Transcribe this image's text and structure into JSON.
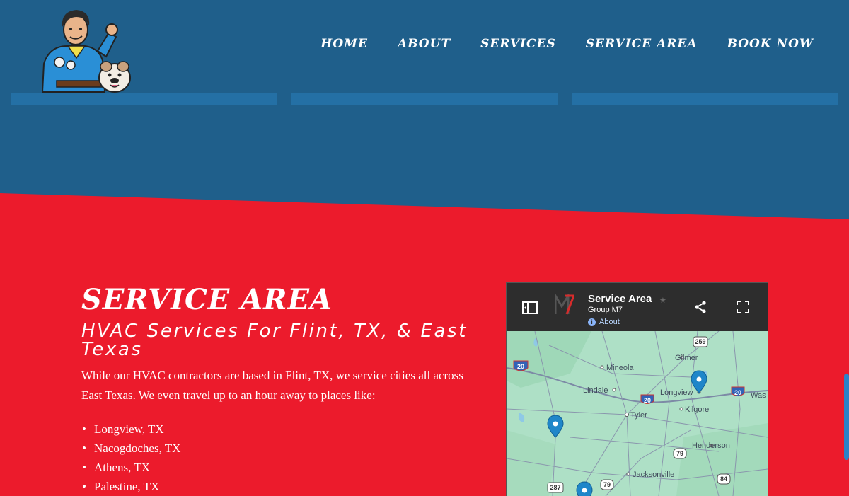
{
  "nav": {
    "items": [
      "HOME",
      "ABOUT",
      "SERVICES",
      "SERVICE AREA",
      "BOOK NOW"
    ]
  },
  "service_area": {
    "title": "SERVICE AREA",
    "subtitle": "HVAC Services For Flint, TX, & East Texas",
    "intro": "While our HVAC contractors are based in Flint, TX, we service cities all across East Texas. We even travel up to an hour away to places like:",
    "places": [
      "Longview, TX",
      "Nacogdoches, TX",
      "Athens, TX",
      "Palestine, TX"
    ]
  },
  "map": {
    "title": "Service Area",
    "owner": "Group M7",
    "about_label": "About",
    "towns": [
      "Gilmer",
      "Mineola",
      "Lindale",
      "Longview",
      "Was",
      "Tyler",
      "Kilgore",
      "Henderson",
      "Jacksonville"
    ],
    "highway_shields": [
      "259",
      "20",
      "20",
      "20",
      "79",
      "287",
      "79",
      "84"
    ],
    "icons": {
      "panel": "side-panel-icon",
      "logo": "m7-logo",
      "star": "star-icon",
      "share": "share-icon",
      "fullscreen": "fullscreen-icon",
      "pin": "map-pin-icon"
    }
  },
  "colors": {
    "header_blue": "#1f5f8b",
    "strip_blue": "#2470a5",
    "red": "#ec1b2c",
    "map_header": "#2d2d2d",
    "pin_blue": "#1f86c9"
  }
}
